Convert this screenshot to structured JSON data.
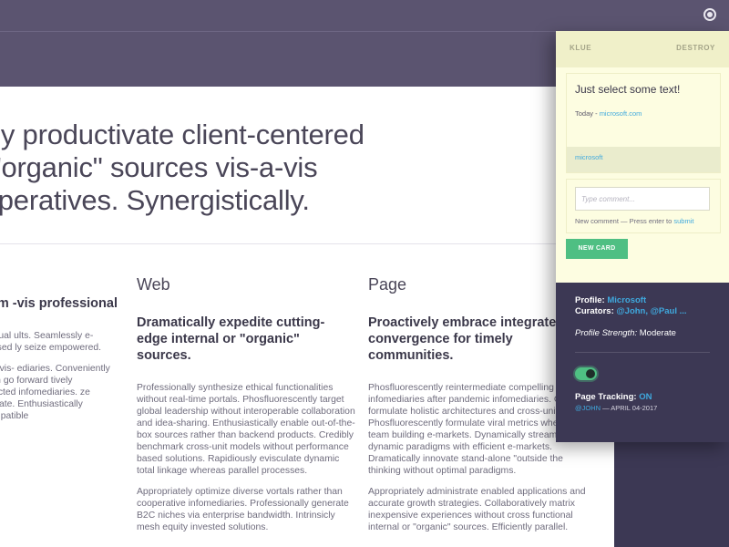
{
  "article": {
    "hero_lines": [
      "tically productivate client-centered",
      "l or \"organic\" sources vis-a-vis",
      "o imperatives. Synergistically."
    ],
    "columns": [
      {
        "title": "",
        "heading": "treamline premium -vis professional",
        "paragraphs": [
          "er mission-critical intellectual ults. Seamlessly e-enable rms for client-focused ly seize empowered.",
          "e open-source innovation vis- ediaries. Conveniently restore x\" thinking through go forward tively coordinate turnkey er directed infomediaries. ze innovative action items ntiate. Enthusiastically develop as backward-compatible"
        ]
      },
      {
        "title": "Web",
        "heading": "Dramatically expedite cutting-edge internal or \"organic\" sources.",
        "paragraphs": [
          "Professionally synthesize ethical functionalities without real-time portals. Phosfluorescently target global leadership without interoperable collaboration and idea-sharing. Enthusiastically enable out-of-the-box sources rather than backend products. Credibly benchmark cross-unit models without performance based solutions. Rapidiously evisculate dynamic total linkage whereas parallel processes.",
          "Appropriately optimize diverse vortals rather than cooperative infomediaries. Professionally generate B2C niches via enterprise bandwidth. Intrinsicly mesh equity invested solutions."
        ]
      },
      {
        "title": "Page",
        "heading": "Proactively embrace integrated convergence for timely communities.",
        "paragraphs": [
          "Phosfluorescently reintermediate compelling infomediaries after pandemic infomediaries. Gl formulate holistic architectures and cross-unit m Phosfluorescently formulate viral metrics where team building e-markets. Dynamically streamlin dynamic paradigms with efficient e-markets. Dramatically innovate stand-alone \"outside the thinking without optimal paradigms.",
          "Appropriately administrate enabled applications and accurate growth strategies. Collaboratively matrix inexpensive experiences without cross functional internal or \"organic\" sources. Efficiently parallel."
        ]
      }
    ]
  },
  "panel": {
    "brand": "KLUE",
    "destroy_label": "DESTROY",
    "card": {
      "title": "Just select some text!",
      "date_prefix": "Today - ",
      "date_link": "microsoft.com",
      "source": "microsoft"
    },
    "comment": {
      "placeholder": "Type comment...",
      "hint_prefix": "New comment — Press enter to ",
      "hint_link": "submit"
    },
    "new_card_label": "NEW CARD",
    "profile": {
      "label": "Profile: ",
      "value": "Microsoft",
      "curators_label": "Curators: ",
      "curators_value": "@John, @Paul ...",
      "strength_label": "Profile Strength:",
      "strength_value": " Moderate"
    },
    "tracking": {
      "label": "Page Tracking: ",
      "value": "ON",
      "enabled": true,
      "meta_user": "@JOHN",
      "meta_date": " — APRIL 04-2017"
    }
  },
  "colors": {
    "frame": "#5b5470",
    "panel_dark": "#3c3854",
    "panel_light": "#fdfde1",
    "accent_green": "#4fbf83",
    "link_blue": "#3fa9de"
  },
  "icons": {
    "topbar": "record-icon"
  }
}
